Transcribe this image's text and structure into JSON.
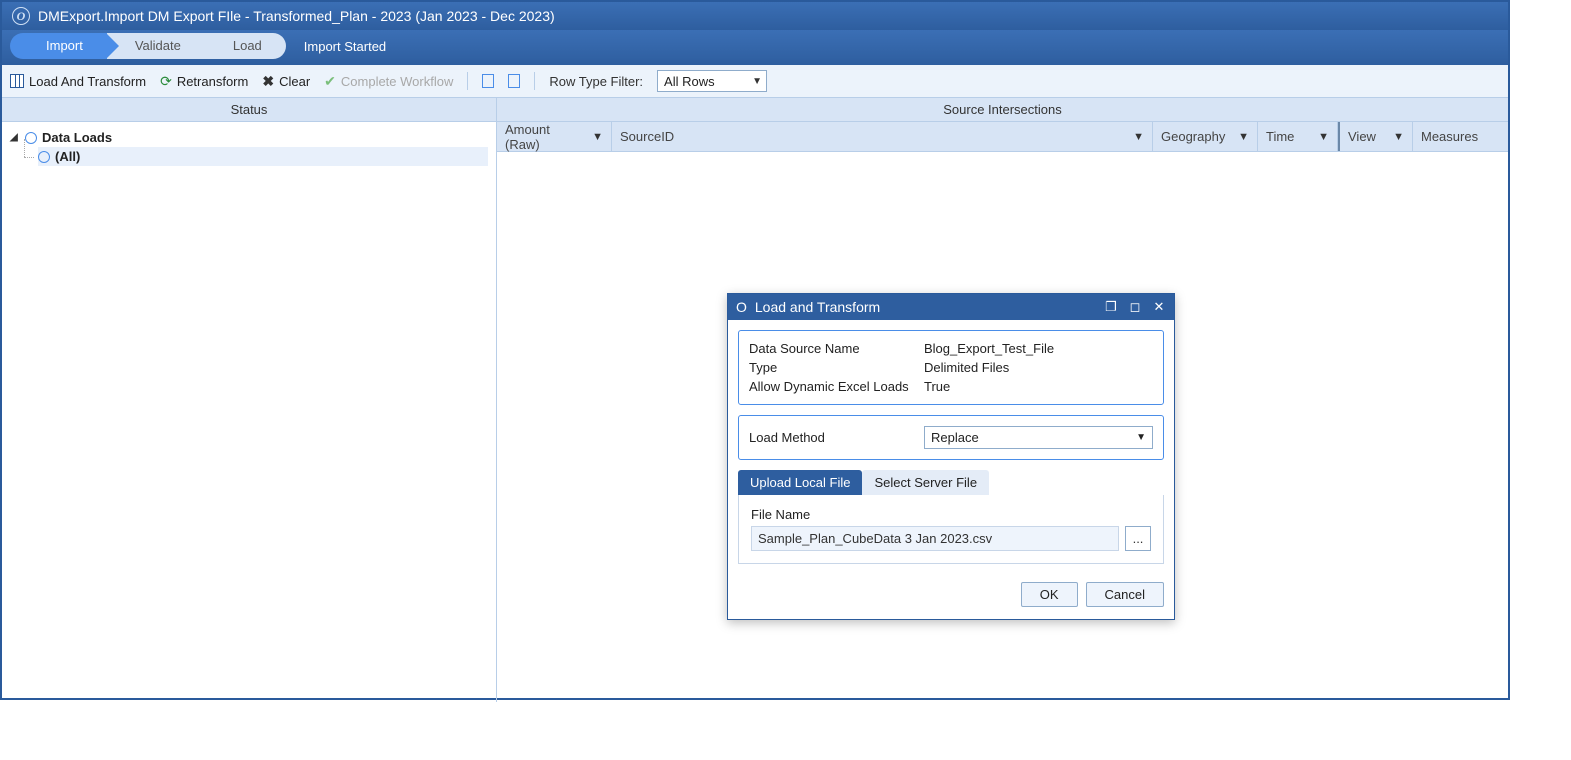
{
  "titlebar": {
    "text": "DMExport.Import DM Export FIle  -  Transformed_Plan  -  2023 (Jan 2023 - Dec 2023)"
  },
  "steps": {
    "import": "Import",
    "validate": "Validate",
    "load": "Load",
    "status": "Import Started"
  },
  "toolbar": {
    "load_transform": "Load And Transform",
    "retransform": "Retransform",
    "clear": "Clear",
    "complete_workflow": "Complete Workflow",
    "row_filter_label": "Row Type Filter:",
    "row_filter_value": "All Rows"
  },
  "left_panel": {
    "header": "Status",
    "root": "Data Loads",
    "child": "(All)"
  },
  "right_panel": {
    "header": "Source Intersections",
    "cols": {
      "amount": "Amount (Raw)",
      "sourceid": "SourceID",
      "geography": "Geography",
      "time": "Time",
      "view": "View",
      "measures": "Measures"
    }
  },
  "dialog": {
    "title": "Load and Transform",
    "ds_name_label": "Data Source Name",
    "ds_name_value": "Blog_Export_Test_File",
    "type_label": "Type",
    "type_value": "Delimited Files",
    "allow_label": "Allow Dynamic Excel Loads",
    "allow_value": "True",
    "load_method_label": "Load Method",
    "load_method_value": "Replace",
    "tab_upload": "Upload Local File",
    "tab_server": "Select Server File",
    "file_name_label": "File Name",
    "file_name_value": "Sample_Plan_CubeData 3 Jan 2023.csv",
    "browse_btn": "...",
    "ok": "OK",
    "cancel": "Cancel"
  }
}
